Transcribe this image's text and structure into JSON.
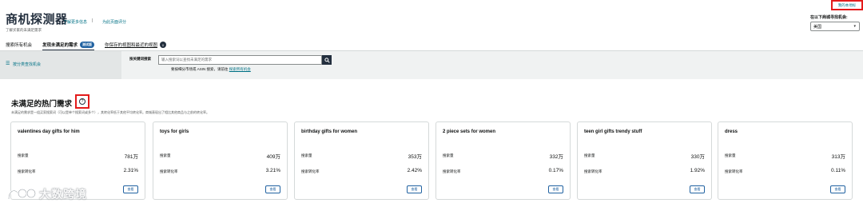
{
  "header": {
    "title": "商机探测器",
    "subtitle": "了解买家的未满足需求",
    "link_learn_more": "了解更多信息",
    "separator": "|",
    "link_feedback": "为此页面评分",
    "top_right_button": "我的本地标",
    "market_label": "在以下商城寻找机会:",
    "market_value": "美国"
  },
  "tabs": [
    {
      "label": "搜索所有机会"
    },
    {
      "label": "发现未满足的需求",
      "badge": "测试版"
    },
    {
      "label": "你保存的视图和最近的视图",
      "badge": "0"
    }
  ],
  "search": {
    "sidebar_label": "按分类查找机会",
    "label": "按关键词搜索",
    "placeholder": "输入搜索词以查找未满足的需求",
    "help_prefix": "要按细分市场或 ASIN 搜索，请前往",
    "help_link": "探索所有机会"
  },
  "section": {
    "title": "未满足的热门需求",
    "description": "未满足的需求是一组买家搜索词（可以是单个搜索词或多个），其转化率低于其他平均转化率。商城表现出了相比其他商品与之前的转化率。"
  },
  "card_labels": {
    "search_volume": "搜索量",
    "conversion_rate": "搜索转化率",
    "view": "查看"
  },
  "cards": [
    {
      "title": "valentines day gifts for him",
      "search_volume": "781万",
      "conversion_rate": "2.31%"
    },
    {
      "title": "toys for girls",
      "search_volume": "409万",
      "conversion_rate": "3.21%"
    },
    {
      "title": "birthday gifts for women",
      "search_volume": "353万",
      "conversion_rate": "2.42%"
    },
    {
      "title": "2 piece sets for women",
      "search_volume": "332万",
      "conversion_rate": "0.17%"
    },
    {
      "title": "teen girl gifts trendy stuff",
      "search_volume": "330万",
      "conversion_rate": "1.92%"
    },
    {
      "title": "dress",
      "search_volume": "313万",
      "conversion_rate": "0.11%"
    }
  ],
  "watermark": {
    "text": "大数跨境"
  },
  "colors": {
    "link": "#007185",
    "highlight": "#e31b1b",
    "dark": "#232f3e",
    "band": "#f0f2f2"
  }
}
